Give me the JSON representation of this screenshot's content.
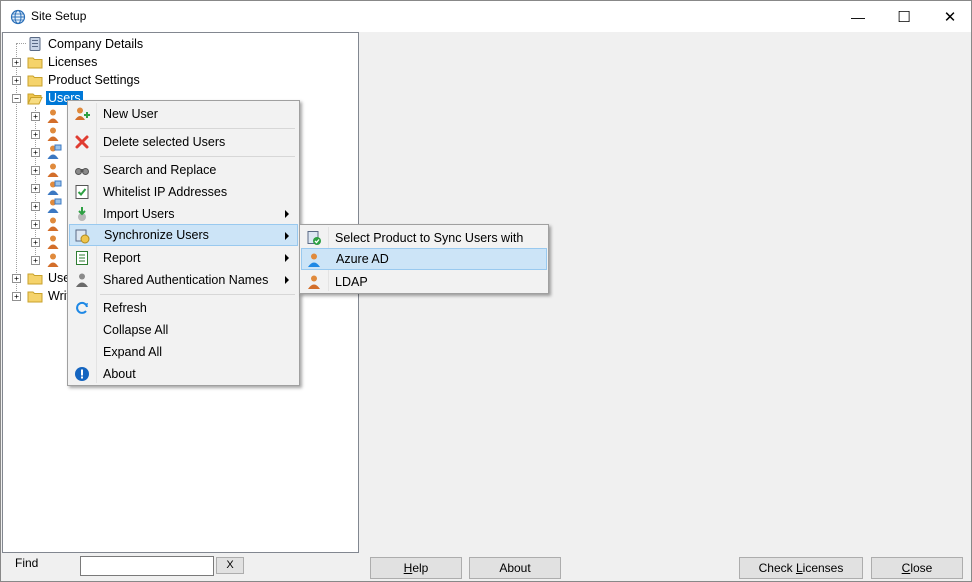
{
  "window": {
    "title": "Site Setup",
    "minimize_glyph": "—",
    "maximize_glyph": "☐",
    "close_glyph": "✕"
  },
  "tree": {
    "items": [
      {
        "label": "Company Details",
        "icon": "database-icon"
      },
      {
        "label": "Licenses",
        "icon": "folder-icon"
      },
      {
        "label": "Product Settings",
        "icon": "folder-icon"
      },
      {
        "label": "Users",
        "icon": "folder-open-icon",
        "selected": true
      },
      {
        "label": "Use",
        "icon": "folder-icon"
      },
      {
        "label": "Writ",
        "icon": "folder-icon"
      }
    ],
    "user_children": 9
  },
  "context_menu": {
    "items": [
      {
        "label": "New User",
        "icon": "add-user-icon"
      },
      {
        "label": "Delete selected Users",
        "icon": "delete-icon"
      },
      {
        "label": "Search and Replace",
        "icon": "binoculars-icon"
      },
      {
        "label": "Whitelist IP Addresses",
        "icon": "checklist-icon"
      },
      {
        "label": "Import Users",
        "icon": "import-icon",
        "submenu": true
      },
      {
        "label": "Synchronize Users",
        "icon": "sync-users-icon",
        "submenu": true,
        "highlighted": true
      },
      {
        "label": "Report",
        "icon": "report-icon",
        "submenu": true
      },
      {
        "label": "Shared Authentication Names",
        "icon": "shared-user-icon",
        "submenu": true
      },
      {
        "label": "Refresh",
        "icon": "refresh-icon"
      },
      {
        "label": "Collapse All",
        "icon": ""
      },
      {
        "label": "Expand All",
        "icon": ""
      },
      {
        "label": "About",
        "icon": "info-icon"
      }
    ]
  },
  "sync_submenu": {
    "items": [
      {
        "label": "Select Product to Sync Users with",
        "icon": "product-check-icon"
      },
      {
        "label": "Azure AD",
        "icon": "azure-user-icon",
        "highlighted": true
      },
      {
        "label": "LDAP",
        "icon": "ldap-user-icon"
      }
    ]
  },
  "bottom": {
    "find_label": "Find",
    "find_value": "",
    "find_clear": "X",
    "help_pre": "",
    "help_u": "H",
    "help_post": "elp",
    "about_label": "About",
    "check_pre": "Check ",
    "check_u": "L",
    "check_post": "icenses",
    "close_pre": "",
    "close_u": "C",
    "close_post": "lose"
  },
  "colors": {
    "selection": "#0078d7",
    "menu_highlight": "#cce4f7",
    "menu_highlight_border": "#99c9ef",
    "menu_bg": "#f2f2f2"
  }
}
